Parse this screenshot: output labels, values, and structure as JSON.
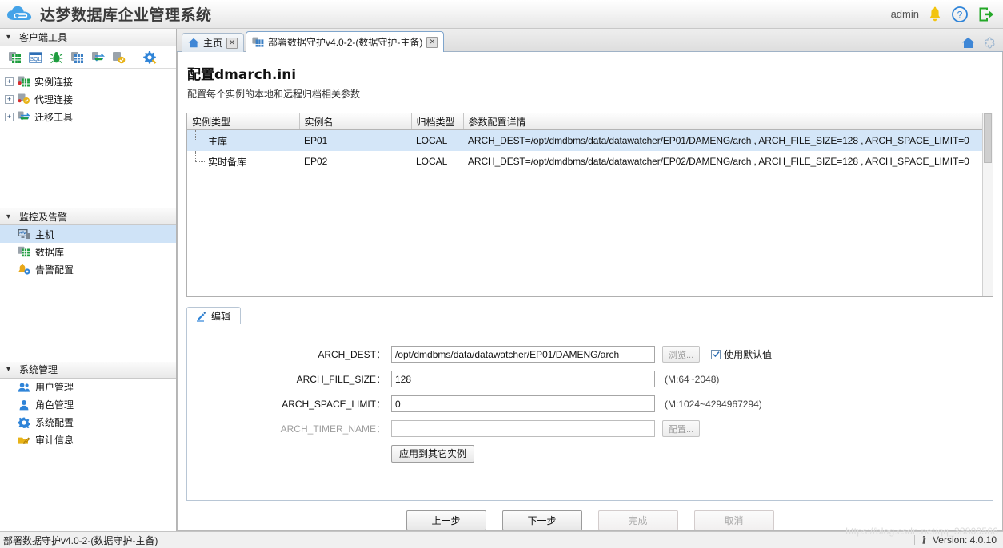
{
  "topbar": {
    "brand_title": "达梦数据库企业管理系统",
    "user": "admin",
    "icons": {
      "logo": "cloud-logo",
      "bell": "bell-icon",
      "help": "help-icon",
      "logout": "logout-icon"
    }
  },
  "sidebar": {
    "sections": [
      {
        "title": "客户端工具",
        "toolbar": [
          {
            "name": "new-instance-connection-icon"
          },
          {
            "name": "sql-console-icon"
          },
          {
            "name": "debug-icon"
          },
          {
            "name": "instance-manage-icon"
          },
          {
            "name": "migrate-icon"
          },
          {
            "name": "agent-icon"
          },
          {
            "name": "settings-icon"
          }
        ],
        "tree": [
          {
            "label": "实例连接",
            "icon": "instance-connection-icon",
            "expander": "+"
          },
          {
            "label": "代理连接",
            "icon": "agent-connection-icon",
            "expander": "+"
          },
          {
            "label": "迁移工具",
            "icon": "migration-tool-icon",
            "expander": "+"
          }
        ]
      },
      {
        "title": "监控及告警",
        "items": [
          {
            "label": "主机",
            "icon": "host-icon",
            "selected": true
          },
          {
            "label": "数据库",
            "icon": "database-icon",
            "selected": false
          },
          {
            "label": "告警配置",
            "icon": "alert-config-icon",
            "selected": false
          }
        ]
      },
      {
        "title": "系统管理",
        "items": [
          {
            "label": "用户管理",
            "icon": "users-icon",
            "selected": false
          },
          {
            "label": "角色管理",
            "icon": "role-icon",
            "selected": false
          },
          {
            "label": "系统配置",
            "icon": "system-config-icon",
            "selected": false
          },
          {
            "label": "审计信息",
            "icon": "audit-icon",
            "selected": false
          }
        ]
      }
    ]
  },
  "tabs": [
    {
      "label": "主页",
      "icon": "home-icon",
      "active": false,
      "close": "✕"
    },
    {
      "label": "部署数据守护v4.0-2-(数据守护-主备)",
      "icon": "deploy-icon",
      "active": true,
      "close": "✕"
    }
  ],
  "tabstrip_right": [
    {
      "name": "home-icon"
    },
    {
      "name": "layout-icon"
    }
  ],
  "wizard": {
    "title": "配置dmarch.ini",
    "subtitle": "配置每个实例的本地和远程归档相关参数",
    "table": {
      "columns": [
        "实例类型",
        "实例名",
        "归档类型",
        "参数配置详情"
      ],
      "rows": [
        {
          "instance_type": "主库",
          "instance_name": "EP01",
          "arch_type": "LOCAL",
          "detail": "ARCH_DEST=/opt/dmdbms/data/datawatcher/EP01/DAMENG/arch , ARCH_FILE_SIZE=128 , ARCH_SPACE_LIMIT=0",
          "selected": true
        },
        {
          "instance_type": "实时备库",
          "instance_name": "EP02",
          "arch_type": "LOCAL",
          "detail": "ARCH_DEST=/opt/dmdbms/data/datawatcher/EP02/DAMENG/arch , ARCH_FILE_SIZE=128 , ARCH_SPACE_LIMIT=0",
          "selected": false
        }
      ]
    },
    "edit_tab": {
      "label": "编辑",
      "icon": "edit-pencil-icon"
    },
    "form": {
      "arch_dest": {
        "label": "ARCH_DEST：",
        "value": "/opt/dmdbms/data/datawatcher/EP01/DAMENG/arch",
        "browse_button": "浏览...",
        "checkbox_label": "使用默认值",
        "checked": true
      },
      "arch_file_size": {
        "label": "ARCH_FILE_SIZE：",
        "value": "128",
        "hint": "(M:64~2048)"
      },
      "arch_space_limit": {
        "label": "ARCH_SPACE_LIMIT：",
        "value": "0",
        "hint": "(M:1024~4294967294)"
      },
      "arch_timer_name": {
        "label": "ARCH_TIMER_NAME：",
        "value": "",
        "config_button": "配置..."
      },
      "apply_button": "应用到其它实例"
    },
    "footer": {
      "prev": "上一步",
      "next": "下一步",
      "finish": "完成",
      "cancel": "取消"
    }
  },
  "statusbar": {
    "left": "部署数据守护v4.0-2-(数据守护-主备)",
    "version": "Version: 4.0.10",
    "info_icon": "info-icon"
  },
  "watermark": "https://blog.csdn.net/qq_33809566",
  "colors": {
    "accent": "#3f87d6",
    "selection": "#d4e6f8",
    "sidebar_selection": "#cfe3f7",
    "bell": "#f2c40e",
    "logout": "#24a828"
  }
}
